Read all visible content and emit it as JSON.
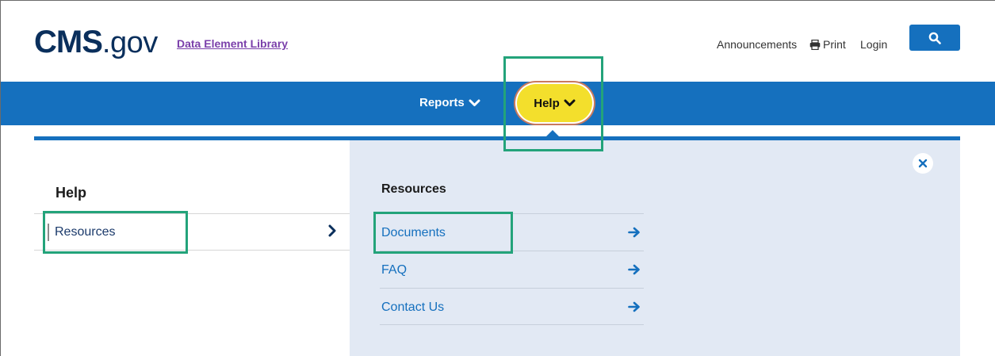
{
  "header": {
    "logo_main": "CMS",
    "logo_suffix": ".gov",
    "library_link": "Data Element Library",
    "utility": {
      "announcements": "Announcements",
      "print": "Print",
      "login": "Login"
    },
    "search_icon": "search-icon"
  },
  "nav": {
    "reports_label": "Reports",
    "help_label": "Help"
  },
  "panel": {
    "left_title": "Help",
    "left_items": [
      {
        "label": "Resources",
        "icon": "chevron-right-icon"
      }
    ],
    "right_title": "Resources",
    "resources": [
      {
        "label": "Documents",
        "icon": "arrow-right-icon"
      },
      {
        "label": "FAQ",
        "icon": "arrow-right-icon"
      },
      {
        "label": "Contact Us",
        "icon": "arrow-right-icon"
      }
    ],
    "close_icon": "close-icon"
  },
  "colors": {
    "brand_blue": "#1570be",
    "logo_navy": "#0a2f5c",
    "help_yellow": "#f3df2c",
    "panel_bg": "#e2e9f4",
    "highlight_green": "#23a37a",
    "link_purple": "#7a3faa"
  }
}
